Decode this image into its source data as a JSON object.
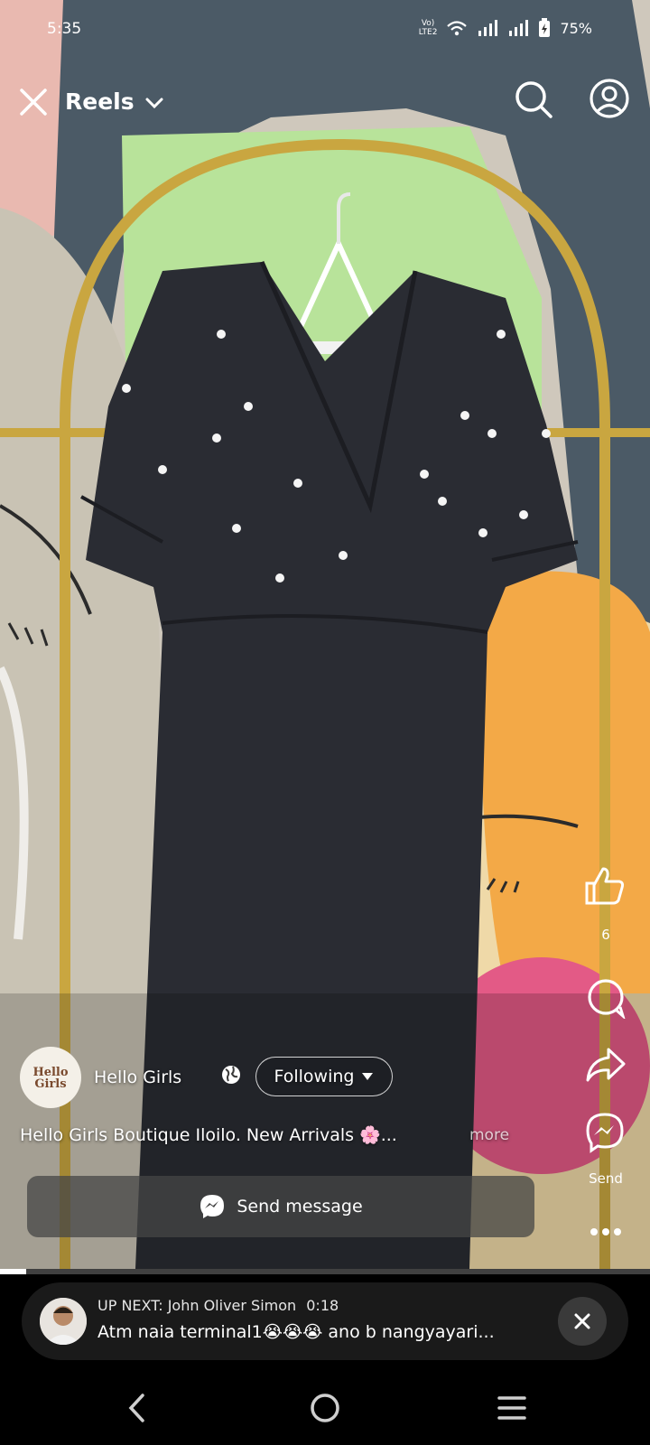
{
  "status_bar": {
    "time": "5:35",
    "network": "Vo) LTE2",
    "battery": "75%"
  },
  "header": {
    "title": "Reels"
  },
  "post": {
    "avatar_text": "Hello Girls",
    "author": "Hello Girls",
    "follow_label": "Following",
    "caption": "Hello Girls Boutique Iloilo. New Arrivals 🌸...",
    "more_label": "more",
    "send_message_label": "Send message"
  },
  "actions": {
    "like_count": "6",
    "send_label": "Send"
  },
  "video": {
    "progress": 0.04
  },
  "up_next": {
    "prefix": "UP NEXT:",
    "author": "John Oliver Simon",
    "duration": "0:18",
    "title": "Atm naia terminal1😭😭😭 ano b nangyayari..."
  },
  "colors": {
    "wall_blue": "#4b5a66",
    "dress": "#2a2c33",
    "rack_gold": "#c9a640",
    "mural_pink": "#e35a86",
    "mural_orange": "#f3a947"
  }
}
